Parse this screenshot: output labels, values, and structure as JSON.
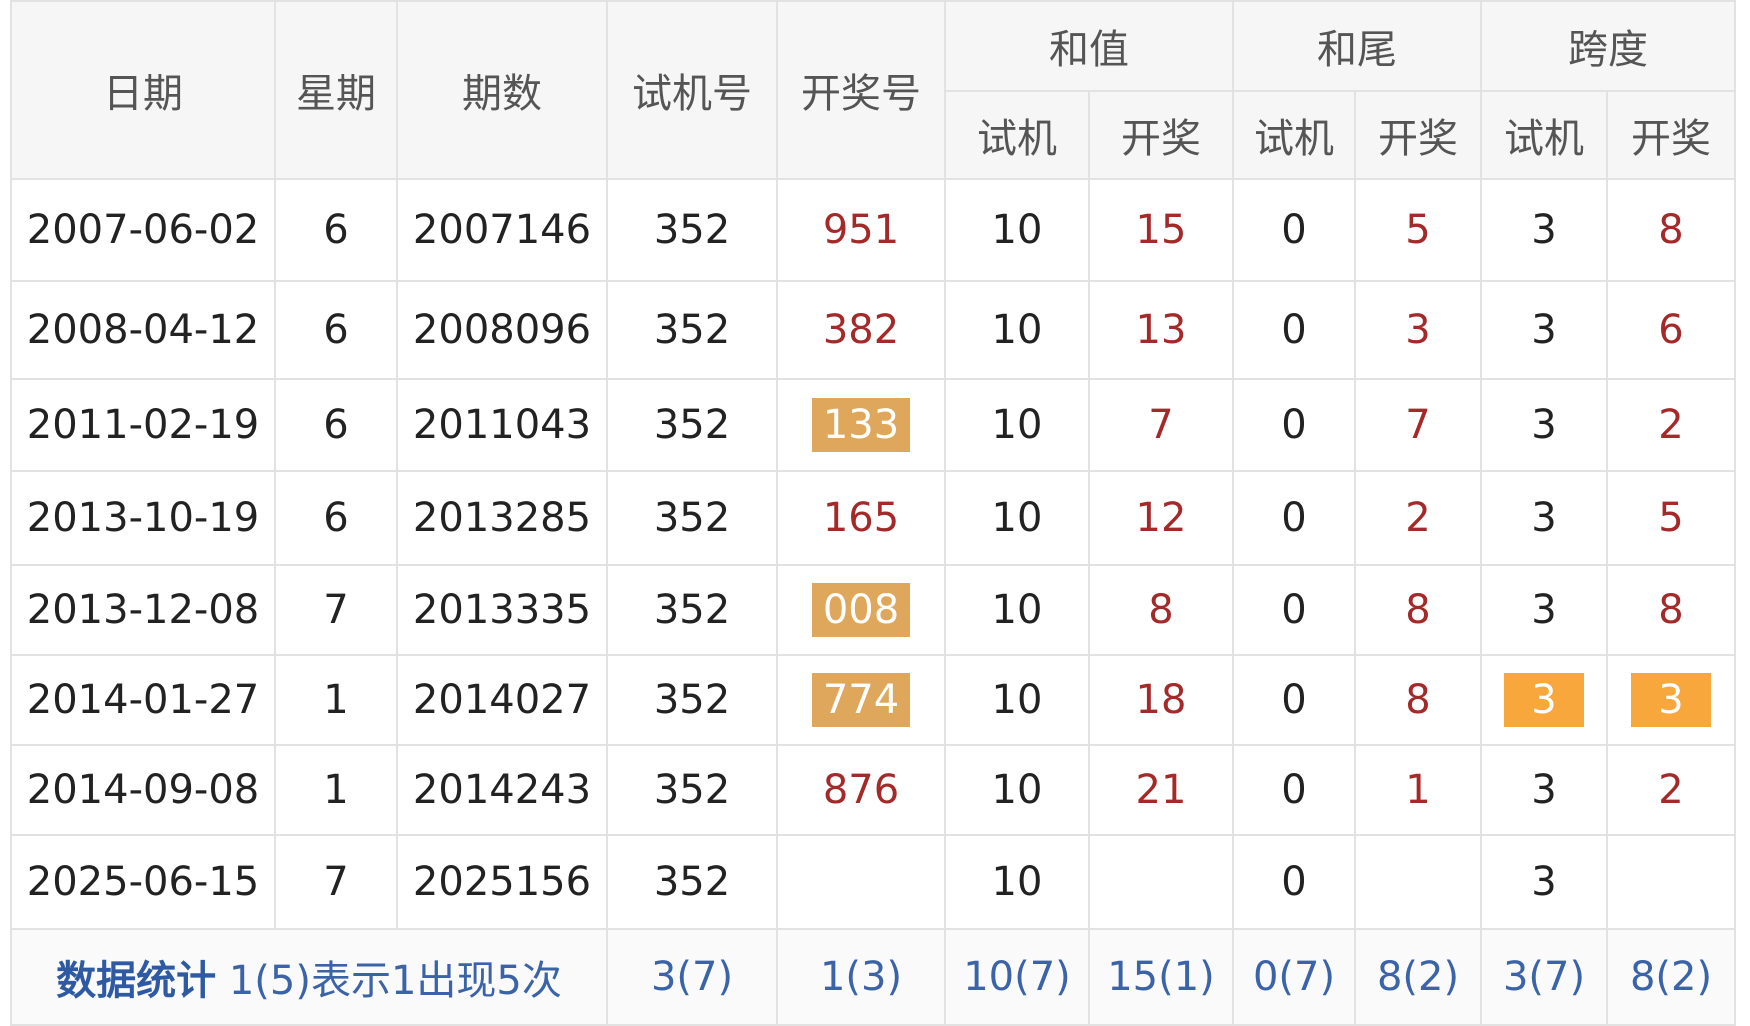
{
  "colors": {
    "header_bg": "#f6f6f6",
    "winning_text": "#a42a2a",
    "highlight_tan": "#dfa75c",
    "highlight_orange": "#f7a73b",
    "stats_text": "#3b63a8"
  },
  "header": {
    "date": "日期",
    "weekday": "星期",
    "issue": "期数",
    "trial_number": "试机号",
    "winning_number": "开奖号",
    "sum_group": "和值",
    "tail_group": "和尾",
    "span_group": "跨度",
    "sub_trial": "试机",
    "sub_winning": "开奖"
  },
  "rows": [
    {
      "date": "2007-06-02",
      "weekday": "6",
      "issue": "2007146",
      "trial": "352",
      "winning": "951",
      "sum_trial": "10",
      "sum_win": "15",
      "tail_trial": "0",
      "tail_win": "5",
      "span_trial": "3",
      "span_win": "8"
    },
    {
      "date": "2008-04-12",
      "weekday": "6",
      "issue": "2008096",
      "trial": "352",
      "winning": "382",
      "sum_trial": "10",
      "sum_win": "13",
      "tail_trial": "0",
      "tail_win": "3",
      "span_trial": "3",
      "span_win": "6"
    },
    {
      "date": "2011-02-19",
      "weekday": "6",
      "issue": "2011043",
      "trial": "352",
      "winning": "133",
      "sum_trial": "10",
      "sum_win": "7",
      "tail_trial": "0",
      "tail_win": "7",
      "span_trial": "3",
      "span_win": "2"
    },
    {
      "date": "2013-10-19",
      "weekday": "6",
      "issue": "2013285",
      "trial": "352",
      "winning": "165",
      "sum_trial": "10",
      "sum_win": "12",
      "tail_trial": "0",
      "tail_win": "2",
      "span_trial": "3",
      "span_win": "5"
    },
    {
      "date": "2013-12-08",
      "weekday": "7",
      "issue": "2013335",
      "trial": "352",
      "winning": "008",
      "sum_trial": "10",
      "sum_win": "8",
      "tail_trial": "0",
      "tail_win": "8",
      "span_trial": "3",
      "span_win": "8"
    },
    {
      "date": "2014-01-27",
      "weekday": "1",
      "issue": "2014027",
      "trial": "352",
      "winning": "774",
      "sum_trial": "10",
      "sum_win": "18",
      "tail_trial": "0",
      "tail_win": "8",
      "span_trial": "3",
      "span_win": "3"
    },
    {
      "date": "2014-09-08",
      "weekday": "1",
      "issue": "2014243",
      "trial": "352",
      "winning": "876",
      "sum_trial": "10",
      "sum_win": "21",
      "tail_trial": "0",
      "tail_win": "1",
      "span_trial": "3",
      "span_win": "2"
    },
    {
      "date": "2025-06-15",
      "weekday": "7",
      "issue": "2025156",
      "trial": "352",
      "winning": "",
      "sum_trial": "10",
      "sum_win": "",
      "tail_trial": "0",
      "tail_win": "",
      "span_trial": "3",
      "span_win": ""
    }
  ],
  "stats": {
    "label": "数据统计",
    "note": "1(5)表示1出现5次",
    "trial": "3(7)",
    "winning": "1(3)",
    "sum_trial": "10(7)",
    "sum_win": "15(1)",
    "tail_trial": "0(7)",
    "tail_win": "8(2)",
    "span_trial": "3(7)",
    "span_win": "8(2)"
  }
}
